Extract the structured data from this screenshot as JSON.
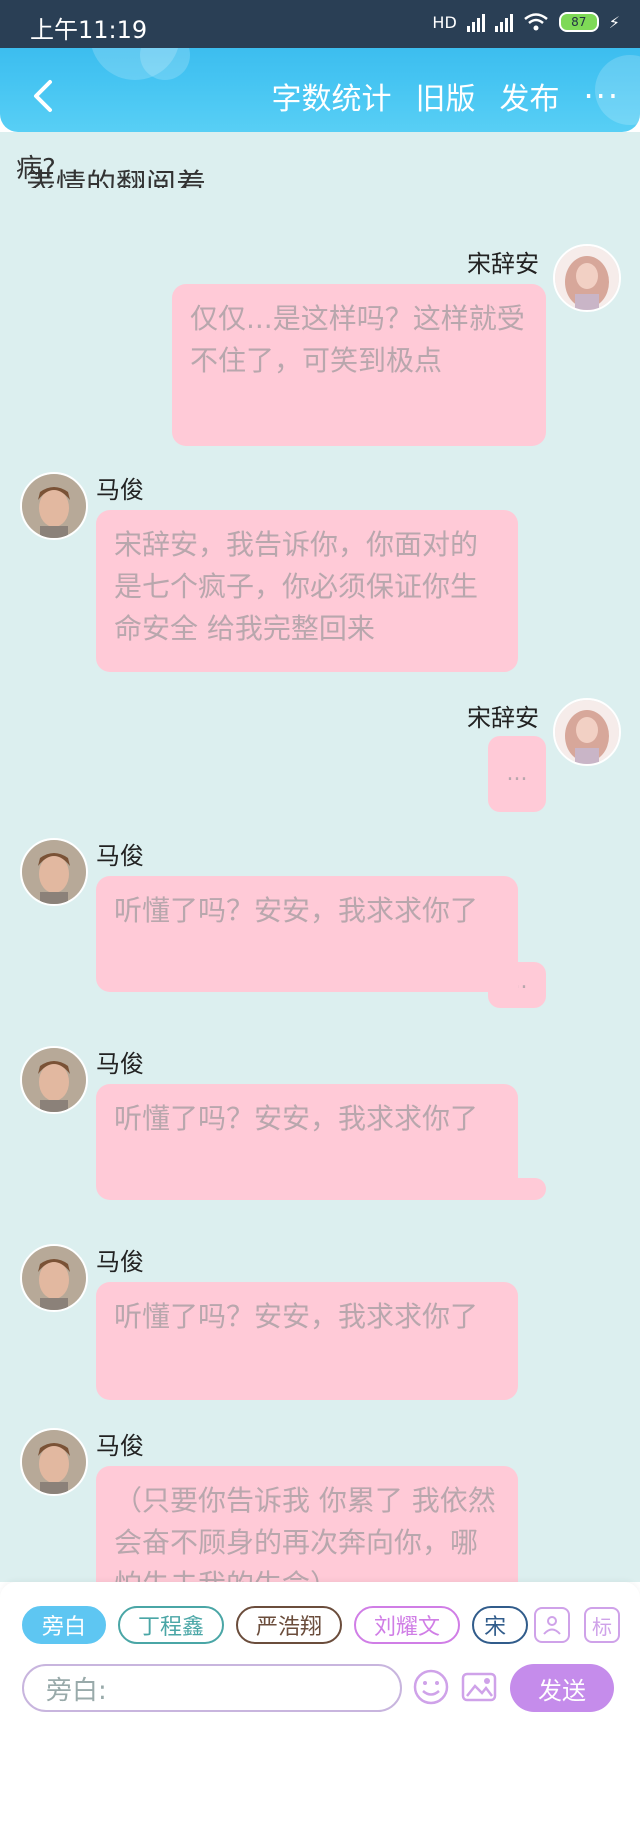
{
  "status_bar": {
    "time": "上午11:19",
    "hd": "HD",
    "battery": "87"
  },
  "nav": {
    "actions": [
      "字数统计",
      "旧版",
      "发布"
    ],
    "more": "···"
  },
  "chat": {
    "preview_text": "病?",
    "cut_text": "表情的翻阅着",
    "messages": [
      {
        "name": "宋辞安",
        "side": "right",
        "text": "仅仅...是这样吗？这样就受不住了，可笑到极点"
      },
      {
        "name": "马俊",
        "side": "left",
        "text": "宋辞安，我告诉你，你面对的是七个疯子，你必须保证你生命安全 给我完整回来"
      },
      {
        "name": "宋辞安",
        "side": "right",
        "text": "..."
      },
      {
        "name": "马俊",
        "side": "left",
        "text": "听懂了吗？安安，我求求你了"
      },
      {
        "name": "马俊",
        "side": "left",
        "text": "听懂了吗？安安，我求求你了"
      },
      {
        "name": "马俊",
        "side": "left",
        "text": "听懂了吗？安安，我求求你了"
      },
      {
        "name": "马俊",
        "side": "left",
        "text": "（只要你告诉我 你累了 我依然会奋不顾身的再次奔向你，哪怕失去我的生命）"
      }
    ],
    "overlap_text": "..."
  },
  "composer": {
    "chips": [
      "旁白",
      "丁程鑫",
      "严浩翔",
      "刘耀文",
      "宋"
    ],
    "mark_label": "标",
    "input_placeholder": "旁白:",
    "send_label": "发送"
  },
  "colors": {
    "topbar": "#45c4f2",
    "chat_bg": "#dcefef",
    "bubble": "#ffcad7",
    "send": "#c58ceb"
  }
}
